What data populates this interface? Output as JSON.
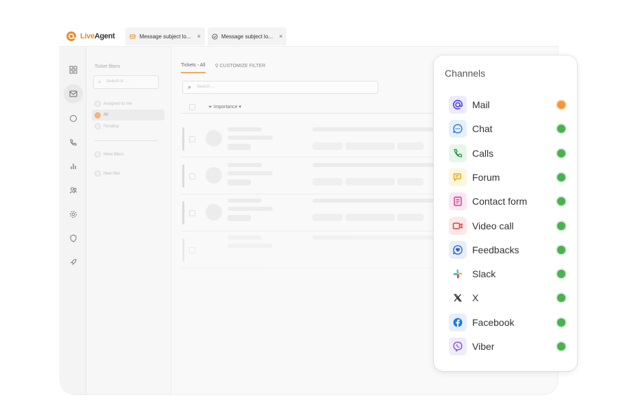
{
  "header": {
    "logo_live": "Live",
    "logo_agent": "Agent",
    "tabs": [
      {
        "label": "Message subject lo...",
        "icon": "envelope-icon"
      },
      {
        "label": "Message subject lo...",
        "icon": "check-circle-icon"
      }
    ]
  },
  "filters": {
    "title": "Ticket filters",
    "search_placeholder": "Search in ...",
    "options": [
      "Assigned to me",
      "All",
      "Pending"
    ],
    "more": [
      "More filters",
      "New filter"
    ]
  },
  "tickets": {
    "tab_label": "Tickets - All",
    "customize_label": "CUSTOMIZE FILTER",
    "search_placeholder": "Search ...",
    "sort_label": "Importance"
  },
  "channels": {
    "title": "Channels",
    "items": [
      {
        "label": "Mail",
        "icon": "mail-at-icon",
        "status": "#f7943e",
        "tint": "#eceafb",
        "fg": "#4b3fd6"
      },
      {
        "label": "Chat",
        "icon": "chat-bubble-icon",
        "status": "#4caf50",
        "tint": "#e6f0fc",
        "fg": "#2f7de0"
      },
      {
        "label": "Calls",
        "icon": "phone-icon",
        "status": "#4caf50",
        "tint": "#e7f6ea",
        "fg": "#2e9a44"
      },
      {
        "label": "Forum",
        "icon": "forum-icon",
        "status": "#4caf50",
        "tint": "#fdf5dc",
        "fg": "#e2ad18"
      },
      {
        "label": "Contact form",
        "icon": "form-icon",
        "status": "#4caf50",
        "tint": "#fbe6f2",
        "fg": "#cc3f8f"
      },
      {
        "label": "Video call",
        "icon": "video-camera-icon",
        "status": "#4caf50",
        "tint": "#fde7e7",
        "fg": "#d9443e"
      },
      {
        "label": "Feedbacks",
        "icon": "feedback-heart-icon",
        "status": "#4caf50",
        "tint": "#e6eefb",
        "fg": "#2f61cf"
      },
      {
        "label": "Slack",
        "icon": "slack-icon",
        "status": "#4caf50",
        "tint": "#ffffff",
        "fg": "#000000"
      },
      {
        "label": "X",
        "icon": "x-logo-icon",
        "status": "#4caf50",
        "tint": "#ffffff",
        "fg": "#333333"
      },
      {
        "label": "Facebook",
        "icon": "facebook-icon",
        "status": "#4caf50",
        "tint": "#e7effc",
        "fg": "#1877f2"
      },
      {
        "label": "Viber",
        "icon": "viber-icon",
        "status": "#4caf50",
        "tint": "#f0ebfb",
        "fg": "#7b52d8"
      }
    ]
  }
}
